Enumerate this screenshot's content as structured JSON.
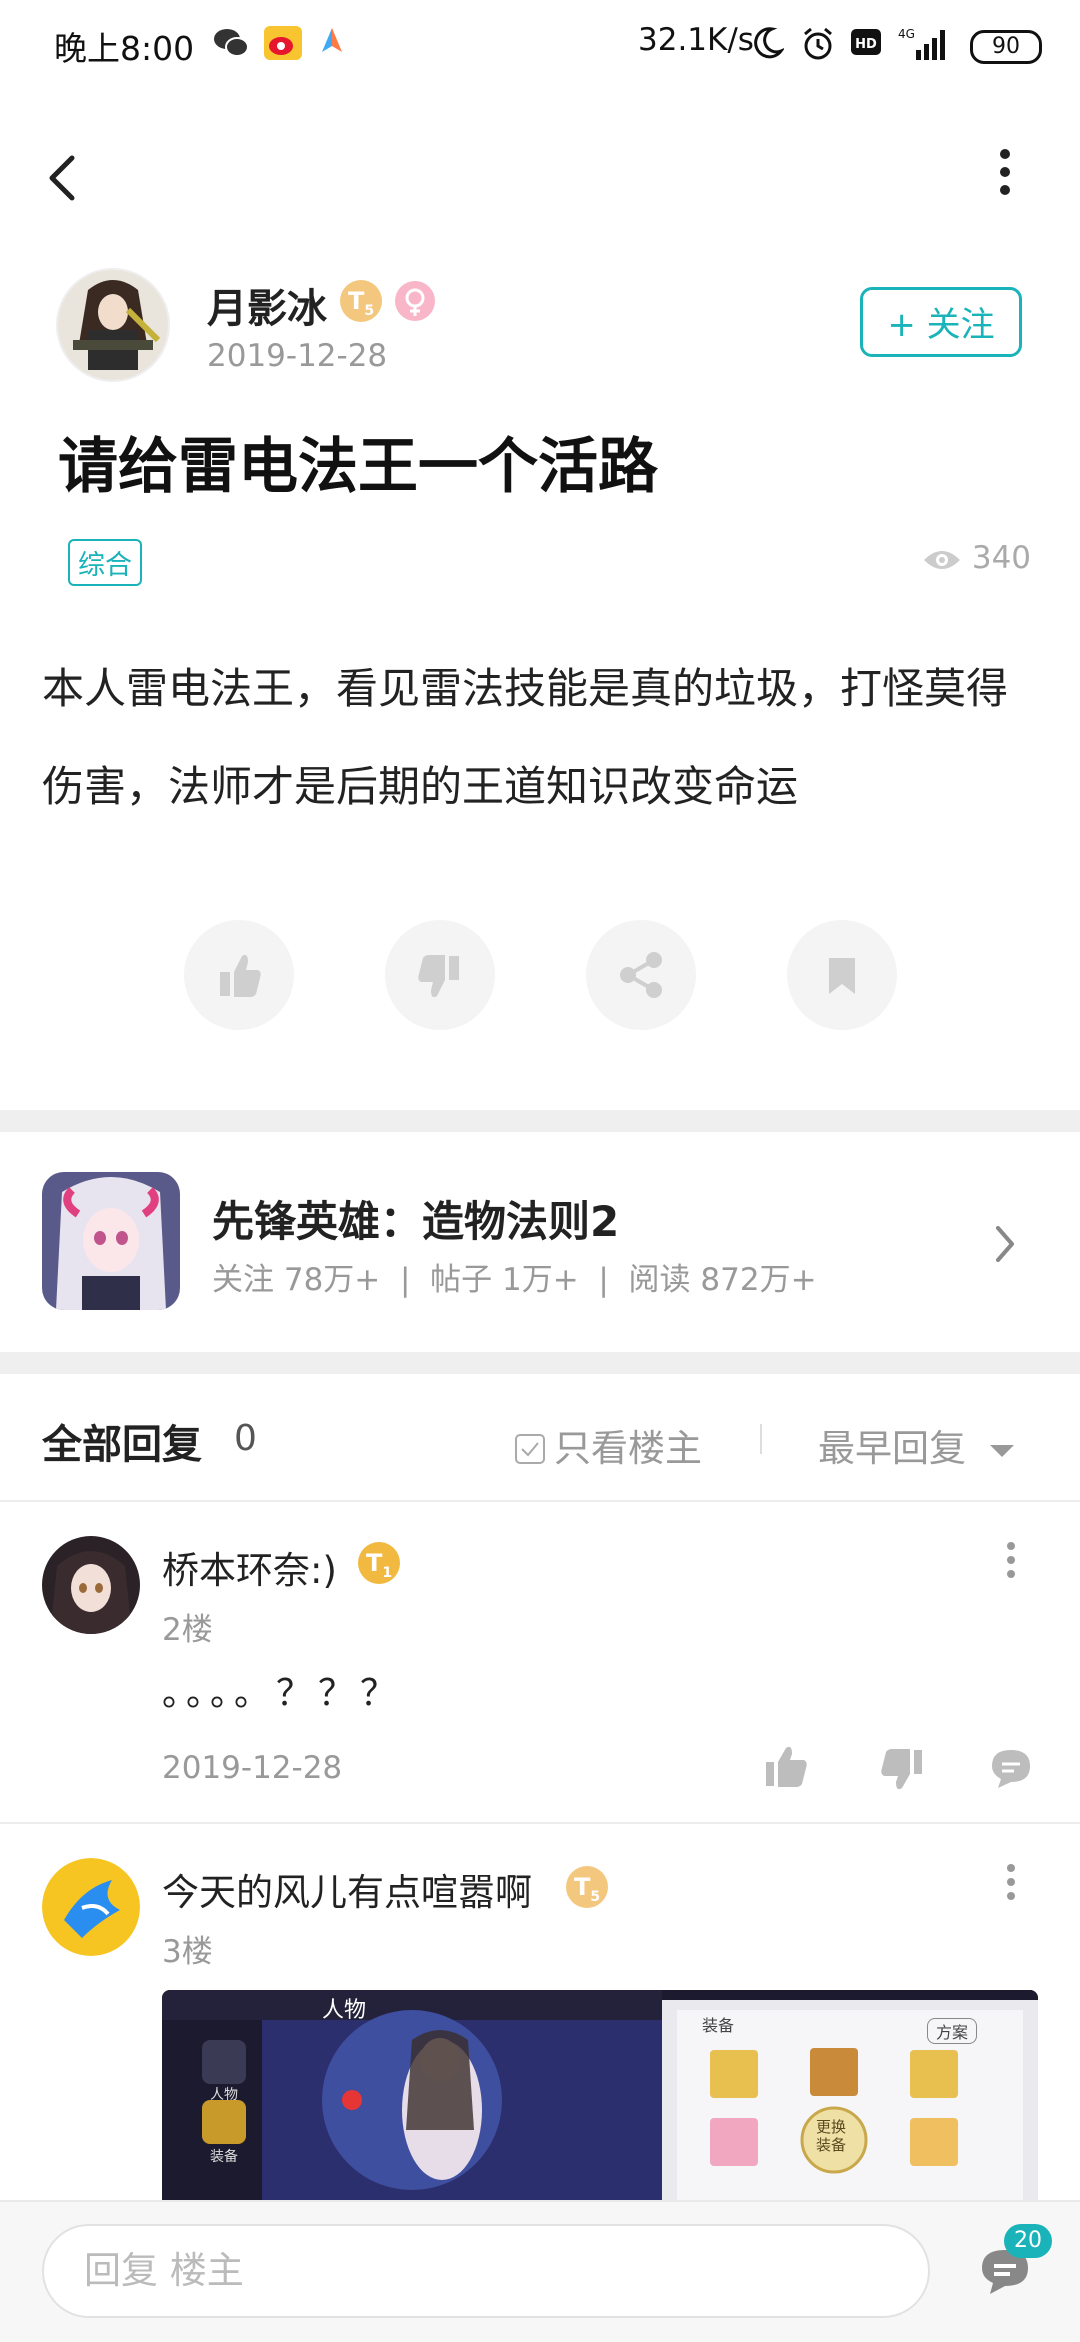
{
  "status_bar": {
    "time": "晚上8:00",
    "network_speed": "32.1K/s",
    "signal": "4G",
    "battery": "90"
  },
  "post": {
    "author": {
      "name": "月影冰",
      "level_badge": "T",
      "level_sub": "5",
      "date": "2019-12-28"
    },
    "follow_label": "+ 关注",
    "title": "请给雷电法王一个活路",
    "tag": "综合",
    "views": "340",
    "body": "本人雷电法王，看见雷法技能是真的垃圾，打怪莫得伤害，法师才是后期的王道知识改变命运"
  },
  "forum": {
    "name": "先锋英雄：造物法则2",
    "stats": "关注 78万+  |  帖子 1万+  |  阅读 872万+"
  },
  "replies_header": {
    "title": "全部回复",
    "count": "0",
    "only_op_label": "只看楼主",
    "sort_label": "最早回复"
  },
  "replies": [
    {
      "name": "桥本环奈:)",
      "badge": "T",
      "badge_sub": "1",
      "floor": "2楼",
      "text": "。。。。？？？",
      "date": "2019-12-28"
    },
    {
      "name": "今天的风儿有点喧嚣啊",
      "badge": "T",
      "badge_sub": "5",
      "floor": "3楼",
      "image": {
        "header_title": "人物",
        "tab_label": "装备",
        "plan_label": "方案",
        "change_label_1": "更换",
        "change_label_2": "装备",
        "side_tab_1": "人物",
        "side_tab_2": "装备"
      }
    }
  ],
  "bottom_bar": {
    "reply_placeholder": "回复  楼主",
    "message_count": "20"
  },
  "colors": {
    "accent": "#19b3b9",
    "badge_gold": "#f2b940",
    "badge_gold_light": "#f4c77e"
  }
}
